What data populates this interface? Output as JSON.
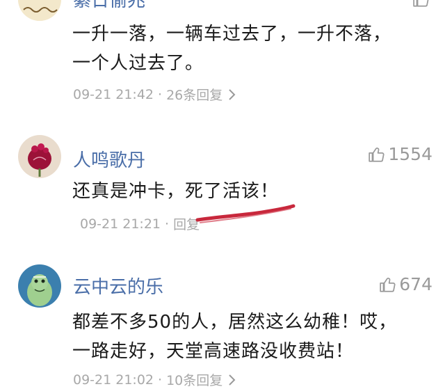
{
  "comments": [
    {
      "username": "綦日偷兆",
      "likes": "",
      "text_lines": [
        "一升一落，一辆车过去了，一升不落，",
        "一个人过去了。"
      ],
      "date": "09-21 21:42",
      "reply": "26条回复",
      "has_chevron": true
    },
    {
      "username": "人鸣歌丹",
      "likes": "1554",
      "text_lines": [
        "还真是冲卡，死了活该！"
      ],
      "date": "09-21 21:21",
      "reply": "回复",
      "has_chevron": false
    },
    {
      "username": "云中云的乐",
      "likes": "674",
      "text_lines": [
        "都差不多50的人，居然这么幼稚！哎，",
        "一路走好，天堂高速路没收费站！"
      ],
      "date": "09-21 21:02",
      "reply": "10条回复",
      "has_chevron": true
    }
  ],
  "icons": {
    "like": "thumbs-up-icon",
    "more": "chevron-right-icon"
  },
  "colors": {
    "username": "#4a6ea8",
    "meta": "#a8a8a8",
    "annotation": "#c8283c"
  }
}
